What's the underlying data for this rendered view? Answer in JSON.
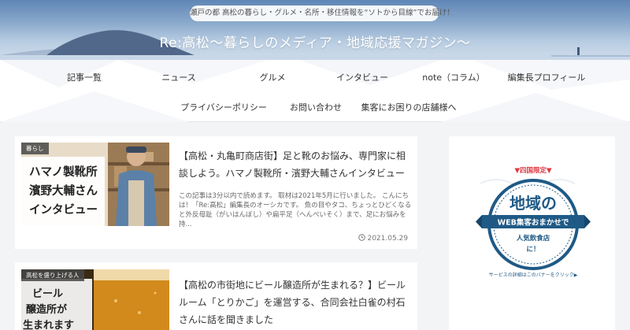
{
  "header": {
    "tagline": "瀬戸の都 高松の暮らし・グルメ・名所・移住情報を“ソトから目線”でお届け！",
    "site_title": "Re:高松〜暮らしのメディア・地域応援マガジン〜"
  },
  "nav": {
    "row1": [
      "記事一覧",
      "ニュース",
      "グルメ",
      "インタビュー",
      "note（コラム）",
      "編集長プロフィール"
    ],
    "row2": [
      "プライバシーポリシー",
      "お問い合わせ",
      "集客にお困りの店舗様へ"
    ]
  },
  "articles": [
    {
      "category": "暮らし",
      "thumb_text": [
        "ハマノ製靴所",
        "濱野大輔さん",
        "インタビュー"
      ],
      "title": "【高松・丸亀町商店街】足と靴のお悩み、専門家に相談しよう。ハマノ製靴所・濱野大輔さんインタビュー",
      "excerpt": "この記事は3分以内で読めます。 取材は2021年5月に行いました。 こんにちは！「Re:高松」編集長のオーシカです。 魚の目やタコ、ちょっとひどくなると外反母趾（がいはんぼし）や扁平足（へんぺいそく）まで、足にお悩みを持...",
      "date": "2021.05.29",
      "date_icon": "clock-icon"
    },
    {
      "category": "高松を盛り上げる人",
      "thumb_text": [
        "ビール",
        "醸造所が",
        "生まれます"
      ],
      "title": "【高松の市街地にビール醸造所が生まれる？】ビールルーム「とりかご」を運営する、合同会社白雀の村石さんに話を聞きました"
    }
  ],
  "sidebar": {
    "ad": {
      "top_label": "▼四国限定▼",
      "heading": "地域の",
      "band": "WEB集客おまかせで",
      "sub1": "人気飲食店",
      "sub2": "に！",
      "footer": "サービスの詳細はこのバナーをクリック▶"
    }
  },
  "colors": {
    "accent_red": "#e0343c",
    "navy": "#1f5a86",
    "header_sky": "#6d92bf",
    "page_bg": "#f3f4f5"
  }
}
